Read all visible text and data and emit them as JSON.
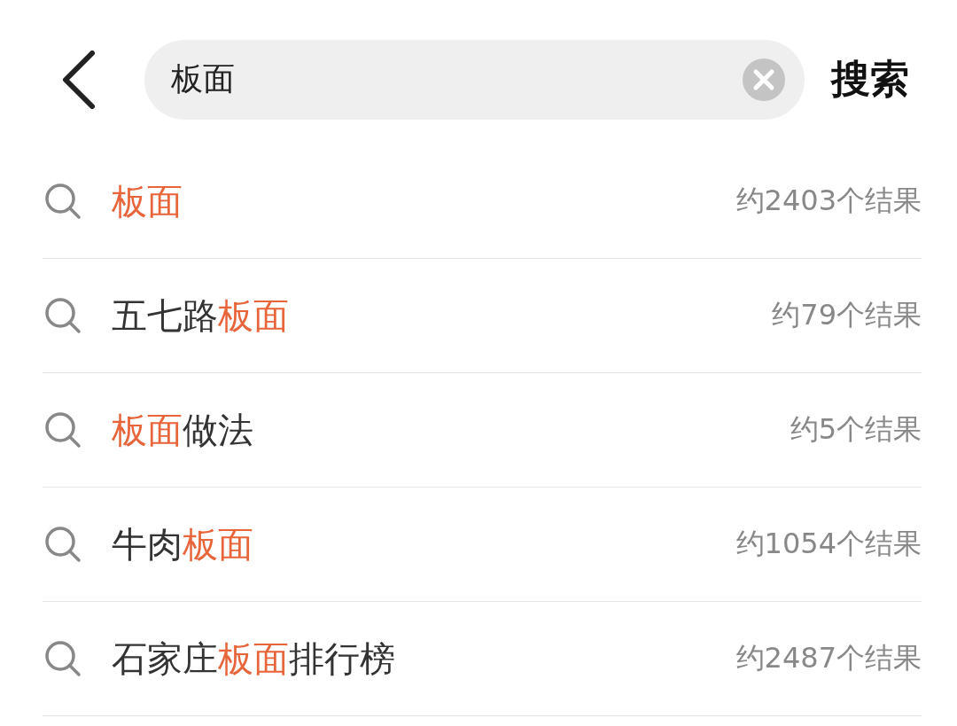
{
  "header": {
    "query": "板面",
    "search_button": "搜索"
  },
  "suggestions": [
    {
      "parts": [
        {
          "text": "板面",
          "highlight": true
        }
      ],
      "count": "约2403个结果"
    },
    {
      "parts": [
        {
          "text": "五七路",
          "highlight": false
        },
        {
          "text": "板面",
          "highlight": true
        }
      ],
      "count": "约79个结果"
    },
    {
      "parts": [
        {
          "text": "板面",
          "highlight": true
        },
        {
          "text": "做法",
          "highlight": false
        }
      ],
      "count": "约5个结果"
    },
    {
      "parts": [
        {
          "text": "牛肉",
          "highlight": false
        },
        {
          "text": "板面",
          "highlight": true
        }
      ],
      "count": "约1054个结果"
    },
    {
      "parts": [
        {
          "text": "石家庄",
          "highlight": false
        },
        {
          "text": "板面",
          "highlight": true
        },
        {
          "text": "排行榜",
          "highlight": false
        }
      ],
      "count": "约2487个结果"
    }
  ]
}
